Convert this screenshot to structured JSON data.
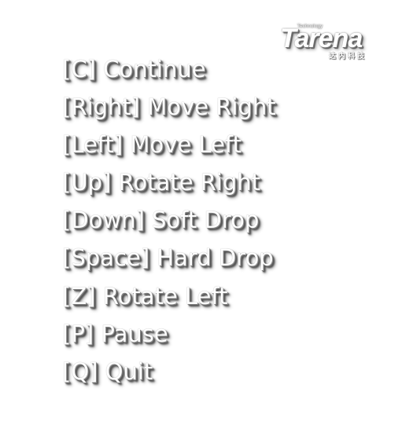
{
  "logo": {
    "brand": "Tarena",
    "tagline": "Technology",
    "chinese": "达内科技"
  },
  "menu": {
    "items": [
      {
        "key": "[C]",
        "action": "Continue",
        "label": "[C] Continue"
      },
      {
        "key": "[Right]",
        "action": "Move Right",
        "label": "[Right] Move Right"
      },
      {
        "key": "[Left]",
        "action": "Move Left",
        "label": "[Left] Move Left"
      },
      {
        "key": "[Up]",
        "action": "Rotate Right",
        "label": "[Up] Rotate Right"
      },
      {
        "key": "[Down]",
        "action": "Soft Drop",
        "label": "[Down] Soft Drop"
      },
      {
        "key": "[Space]",
        "action": "Hard Drop",
        "label": "[Space] Hard Drop"
      },
      {
        "key": "[Z]",
        "action": "Rotate Left",
        "label": "[Z] Rotate Left"
      },
      {
        "key": "[P]",
        "action": "Pause",
        "label": "[P] Pause"
      },
      {
        "key": "[Q]",
        "action": "Quit",
        "label": "[Q] Quit"
      }
    ]
  }
}
